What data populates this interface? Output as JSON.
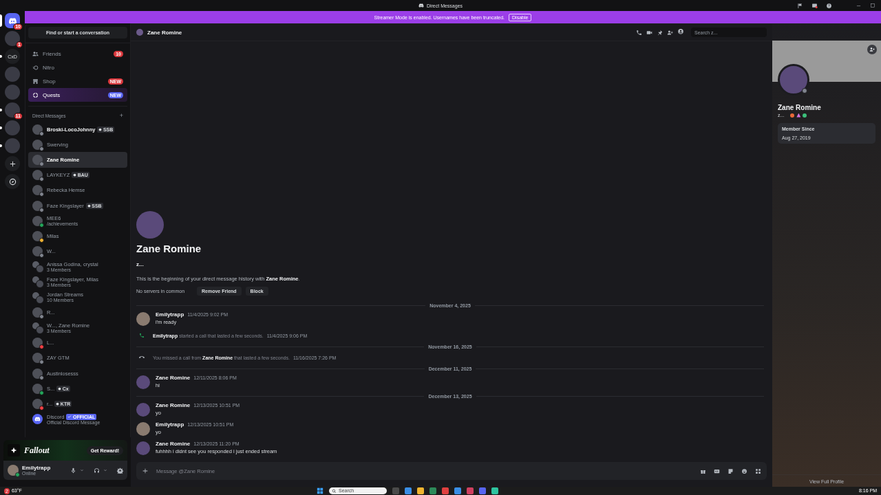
{
  "window": {
    "title": "Direct Messages"
  },
  "banner": {
    "text": "Streamer Mode is enabled. Usernames have been truncated.",
    "button": "Disable"
  },
  "servers": [
    {
      "kind": "home",
      "badge": "10",
      "selected": true,
      "unread": false
    },
    {
      "kind": "avatar",
      "badge": "1",
      "selected": false,
      "unread": false
    },
    {
      "kind": "text",
      "label": "CxD",
      "selected": false,
      "unread": true
    },
    {
      "kind": "avatar",
      "selected": false,
      "unread": false
    },
    {
      "kind": "avatar",
      "selected": false,
      "unread": false
    },
    {
      "kind": "avatar",
      "badge": "11",
      "selected": false,
      "unread": true
    },
    {
      "kind": "avatar",
      "selected": false,
      "unread": true
    },
    {
      "kind": "avatar",
      "selected": false,
      "unread": true
    },
    {
      "kind": "add",
      "selected": false,
      "unread": false
    },
    {
      "kind": "discover",
      "selected": false,
      "unread": false
    }
  ],
  "search": {
    "placeholder": "Find or start a conversation"
  },
  "nav": [
    {
      "kind": "friends",
      "label": "Friends",
      "badge": "10",
      "color": "#da373c",
      "selected": false
    },
    {
      "kind": "nitro",
      "label": "Nitro",
      "selected": false
    },
    {
      "kind": "shop",
      "label": "Shop",
      "badge": "NEW",
      "color": "#da373c",
      "selected": false
    },
    {
      "kind": "quests",
      "label": "Quests",
      "badge": "NEW",
      "color": "#5865f2",
      "selected": true
    }
  ],
  "dm_header": {
    "title": "Direct Messages",
    "add": "+"
  },
  "dms": [
    {
      "kind": "user",
      "name": "Broski-LocoJohnny",
      "tag": {
        "kind": "guild",
        "text": "SSB"
      },
      "color": "#80848e",
      "selected": false,
      "unread": true
    },
    {
      "kind": "user",
      "name": "Swerving",
      "color": "#80848e",
      "selected": false,
      "unread": false
    },
    {
      "kind": "user",
      "name": "Zane Romine",
      "color": "#80848e",
      "selected": true,
      "unread": false
    },
    {
      "kind": "user",
      "name": "LAYKEYZ",
      "tag": {
        "kind": "guild",
        "text": "BAU"
      },
      "color": "#80848e",
      "selected": false,
      "unread": false
    },
    {
      "kind": "user",
      "name": "Rebecka Hemse",
      "color": "#80848e",
      "selected": false,
      "unread": false
    },
    {
      "kind": "user",
      "name": "Faze Kingslayer",
      "tag": {
        "kind": "guild",
        "text": "SSB"
      },
      "color": "#80848e",
      "selected": false,
      "unread": false
    },
    {
      "kind": "user",
      "name": "MEE6",
      "subtitle": "/achievements",
      "color": "#23a55a",
      "selected": false,
      "unread": false
    },
    {
      "kind": "user",
      "name": "Milas",
      "color": "#f0b232",
      "selected": false,
      "unread": false
    },
    {
      "kind": "user",
      "name": "W...",
      "color": "#80848e",
      "selected": false,
      "unread": false
    },
    {
      "kind": "group",
      "name": "Anissa Godina, crystal",
      "subtitle": "3 Members",
      "selected": false,
      "unread": false
    },
    {
      "kind": "group",
      "name": "Faze Kingslayer, Milas",
      "subtitle": "3 Members",
      "selected": false,
      "unread": false
    },
    {
      "kind": "group",
      "name": "Jordan Streams",
      "subtitle": "10 Members",
      "selected": false,
      "unread": false
    },
    {
      "kind": "user",
      "name": "R...",
      "color": "#80848e",
      "selected": false,
      "unread": false
    },
    {
      "kind": "group",
      "name": "W..., Zane Romine",
      "subtitle": "3 Members",
      "selected": false,
      "unread": false
    },
    {
      "kind": "user",
      "name": "L...",
      "color": "#f23f43",
      "selected": false,
      "unread": false
    },
    {
      "kind": "user",
      "name": "ZAY GTM",
      "color": "#80848e",
      "selected": false,
      "unread": false
    },
    {
      "kind": "user",
      "name": "Austinlosesss",
      "color": "#80848e",
      "selected": false,
      "unread": false
    },
    {
      "kind": "user",
      "name": "S...",
      "tag": {
        "kind": "guild",
        "text": "Cx"
      },
      "color": "#23a55a",
      "selected": false,
      "unread": false
    },
    {
      "kind": "user",
      "name": "r...",
      "tag": {
        "kind": "guild",
        "text": "KTR"
      },
      "color": "#f23f43",
      "selected": false,
      "unread": false
    },
    {
      "kind": "system",
      "name": "Discord",
      "tag": {
        "kind": "official",
        "text": "OFFICIAL"
      },
      "subtitle": "Official Discord Message",
      "selected": false,
      "unread": false
    }
  ],
  "promo": {
    "logo": "Fallout",
    "button": "Get Reward!"
  },
  "user_panel": {
    "name": "Emilytrapp",
    "status_text": "Online",
    "color": "#23a55a"
  },
  "chat": {
    "title": "Zane Romine",
    "search": {
      "placeholder": "Search z..."
    },
    "intro": {
      "name": "Zane Romine",
      "handle": "z...",
      "text": "This is the beginning of your direct message history with **Zane Romine**.",
      "mutual": "No servers in common",
      "buttons": [
        "Remove Friend",
        "Block"
      ]
    },
    "timeline": [
      {
        "kind": "divider",
        "text": "November 4, 2025"
      },
      {
        "kind": "message",
        "author": "Emilytrapp",
        "time": "11/4/2025 9:02 PM",
        "text": "i'm ready"
      },
      {
        "kind": "call",
        "missed": false,
        "text": "**Emilytrapp** started a call that lasted a few seconds.",
        "time": "11/4/2025 9:06 PM"
      },
      {
        "kind": "divider",
        "text": "November 16, 2025"
      },
      {
        "kind": "call",
        "missed": true,
        "text": "You missed a call from **Zane Romine** that lasted a few seconds.",
        "time": "11/16/2025 7:26 PM"
      },
      {
        "kind": "divider",
        "text": "December 11, 2025"
      },
      {
        "kind": "message",
        "author": "Zane Romine",
        "time": "12/11/2025 8:06 PM",
        "text": "hi"
      },
      {
        "kind": "divider",
        "text": "December 13, 2025"
      },
      {
        "kind": "message",
        "author": "Zane Romine",
        "time": "12/13/2025 10:51 PM",
        "text": "yo"
      },
      {
        "kind": "message",
        "author": "Emilytrapp",
        "time": "12/13/2025 10:51 PM",
        "text": "yo"
      },
      {
        "kind": "message",
        "author": "Zane Romine",
        "time": "12/13/2025 11:20 PM",
        "text": "fuhhhh i didnt see you responded i just ended stream"
      }
    ],
    "composer": {
      "placeholder": "Message @Zane Romine"
    }
  },
  "profile": {
    "name": "Zane Romine",
    "handle": "z...",
    "color": "#80848e",
    "member_label": "Member Since",
    "member_since": "Aug 27, 2019",
    "link": "View Full Profile"
  },
  "taskbar": {
    "weather_badge": "2",
    "temperature": "63°F",
    "search": {
      "placeholder": "Search"
    },
    "time": "8:16 PM"
  }
}
